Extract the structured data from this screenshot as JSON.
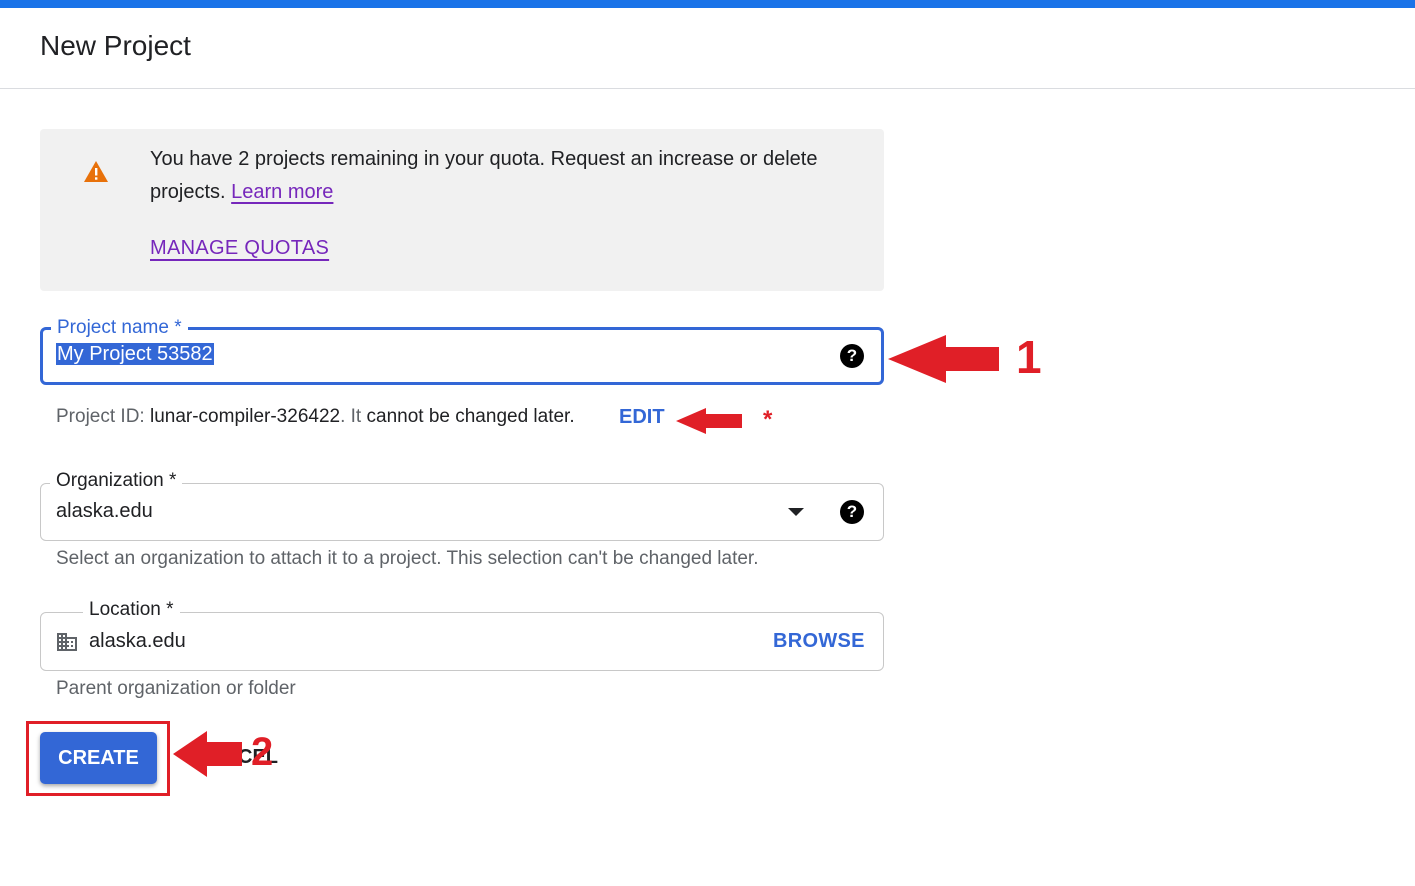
{
  "header": {
    "title": "New Project"
  },
  "quota": {
    "message": "You have 2 projects remaining in your quota. Request an increase or delete projects.",
    "learn_more": "Learn more",
    "manage_quotas": "MANAGE QUOTAS",
    "icon": "warning-icon"
  },
  "project_name": {
    "label": "Project name *",
    "value": "My Project 53582",
    "help_icon": "help-icon"
  },
  "project_id": {
    "prefix": "Project ID: ",
    "id": "lunar-compiler-326422",
    "middle": ". It ",
    "cannot_change": "cannot be changed later.",
    "edit": "EDIT"
  },
  "organization": {
    "label": "Organization *",
    "value": "alaska.edu",
    "helper": "Select an organization to attach it to a project. This selection can't be changed later."
  },
  "location": {
    "label": "Location *",
    "value": "alaska.edu",
    "browse": "BROWSE",
    "helper": "Parent organization or folder"
  },
  "actions": {
    "create": "CREATE",
    "cancel": "CEL"
  },
  "annotations": {
    "step_1": "1",
    "step_2": "2",
    "asterisk": "*",
    "color": "#e01f27"
  },
  "colors": {
    "accent": "#3367d6",
    "top_bar": "#1a73e8",
    "warning": "#e8710a",
    "link": "#7627bb"
  }
}
